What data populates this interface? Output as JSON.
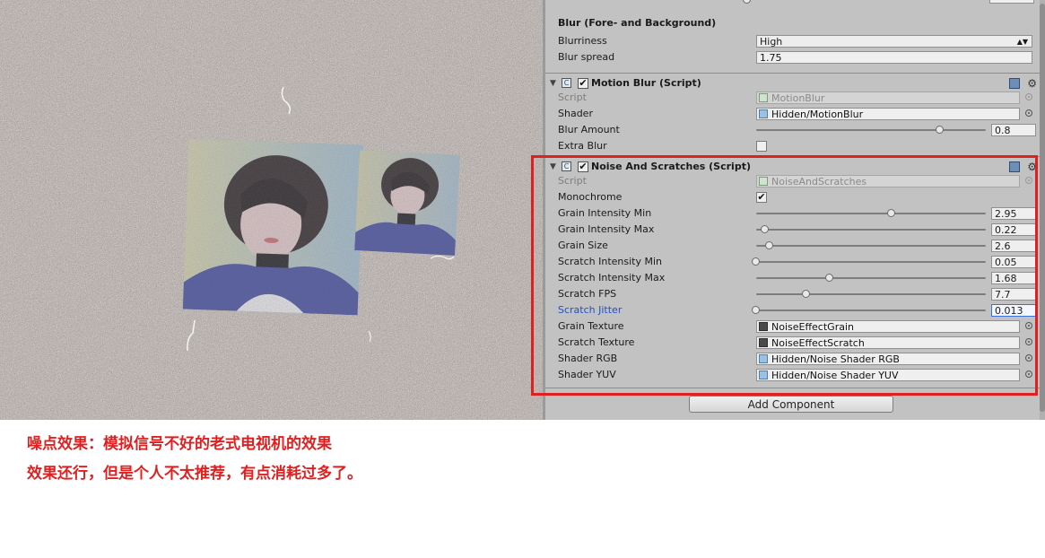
{
  "scene": {
    "icon_name": "noise-grain-scene",
    "watermark": "",
    "photos_icon": "portrait-photo"
  },
  "inspector": {
    "blur_section": {
      "header": "Blur (Fore- and Background)",
      "blurriness_label": "Blurriness",
      "blurriness_value": "High",
      "blur_spread_label": "Blur spread",
      "blur_spread_value": "1.75"
    },
    "motion_blur": {
      "title": "Motion Blur (Script)",
      "enabled": true,
      "script_label": "Script",
      "script_value": "MotionBlur",
      "shader_label": "Shader",
      "shader_value": "Hidden/MotionBlur",
      "blur_amount_label": "Blur Amount",
      "blur_amount_value": "0.8",
      "blur_amount_fraction": 0.8,
      "extra_blur_label": "Extra Blur",
      "extra_blur_checked": false
    },
    "noise": {
      "title": "Noise And Scratches (Script)",
      "enabled": true,
      "script_label": "Script",
      "script_value": "NoiseAndScratches",
      "monochrome_label": "Monochrome",
      "monochrome_checked": true,
      "sliders": [
        {
          "label": "Grain Intensity Min",
          "value": "2.95",
          "fraction": 0.59
        },
        {
          "label": "Grain Intensity Max",
          "value": "0.22",
          "fraction": 0.04
        },
        {
          "label": "Grain Size",
          "value": "2.6",
          "fraction": 0.06
        },
        {
          "label": "Scratch Intensity Min",
          "value": "0.05",
          "fraction": 0.0
        },
        {
          "label": "Scratch Intensity Max",
          "value": "1.68",
          "fraction": 0.32
        },
        {
          "label": "Scratch FPS",
          "value": "7.7",
          "fraction": 0.22
        },
        {
          "label": "Scratch Jitter",
          "value": "0.013",
          "fraction": 0.0
        }
      ],
      "grain_texture_label": "Grain Texture",
      "grain_texture_value": "NoiseEffectGrain",
      "scratch_texture_label": "Scratch Texture",
      "scratch_texture_value": "NoiseEffectScratch",
      "shader_rgb_label": "Shader RGB",
      "shader_rgb_value": "Hidden/Noise Shader RGB",
      "shader_yuv_label": "Shader YUV",
      "shader_yuv_value": "Hidden/Noise Shader YUV"
    },
    "add_component_label": "Add Component",
    "colors": {
      "panel_bg": "#c2c2c2",
      "highlight": "#e02020",
      "active_label": "#2250c8"
    }
  },
  "caption": {
    "line1": "噪点效果：模拟信号不好的老式电视机的效果",
    "line2": "效果还行，但是个人不太推荐，有点消耗过多了。"
  }
}
